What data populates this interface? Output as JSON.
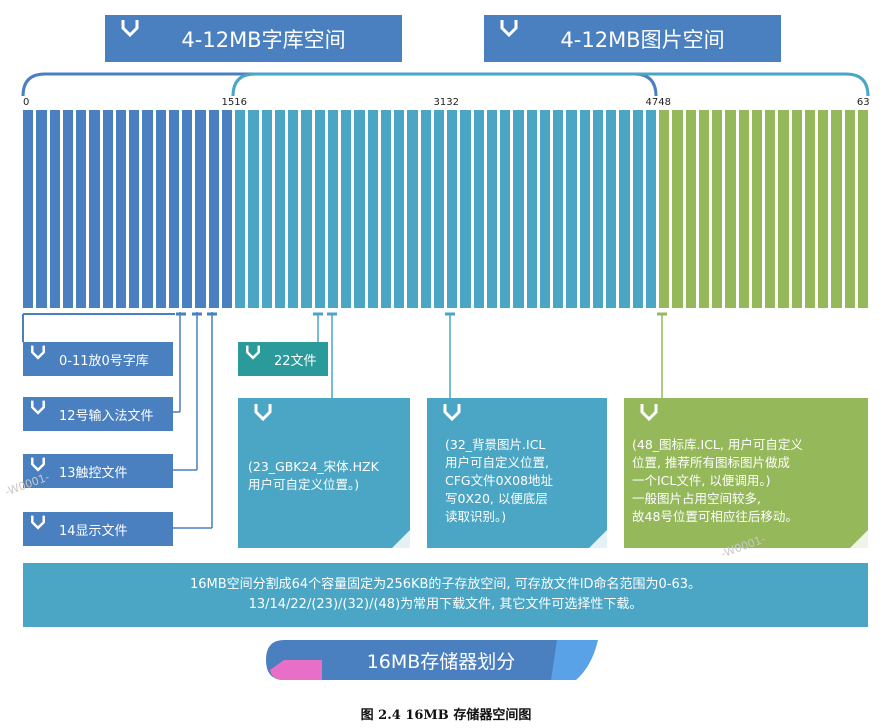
{
  "headers": {
    "font_space": "4-12MB字库空间",
    "image_space": "4-12MB图片空间"
  },
  "bar": {
    "cells": 64,
    "groups": [
      {
        "from": 0,
        "to": 15,
        "color": "#4a7fc0"
      },
      {
        "from": 16,
        "to": 47,
        "color": "#4aa6c4"
      },
      {
        "from": 48,
        "to": 63,
        "color": "#94b85a"
      }
    ],
    "labels": [
      {
        "text": "0",
        "index": 0
      },
      {
        "text": "1516",
        "index": 15.5
      },
      {
        "text": "3132",
        "index": 31.5
      },
      {
        "text": "4748",
        "index": 47.5
      },
      {
        "text": "63",
        "index": 63
      }
    ]
  },
  "tags": {
    "font0": "0-11放0号字库",
    "ime": "12号输入法文件",
    "touch": "13触控文件",
    "display": "14显示文件",
    "file22": "22文件"
  },
  "boxes": {
    "box23": [
      "(23_GBK24_宋体.HZK",
      "用户可自定义位置。)"
    ],
    "box32": [
      "(32_背景图片.ICL",
      "用户可自定义位置,",
      "CFG文件0X08地址",
      "写0X20, 以便底层",
      "读取识别。)"
    ],
    "box48": [
      "(48_图标库.ICL, 用户可自定义",
      "位置, 推荐所有图标图片做成",
      "一个ICL文件, 以便调用。)",
      "一般图片占用空间较多,",
      "故48号位置可相应往后移动。"
    ]
  },
  "info": {
    "line1": "16MB空间分割成64个容量固定为256KB的子存放空间, 可存放文件ID命名范围为0-63。",
    "line2": "13/14/22/(23)/(32)/(48)为常用下载文件, 其它文件可选择性下载。"
  },
  "title_banner": "16MB存储器划分",
  "caption": "图 2.4 16MB 存储器空间图",
  "watermarks": [
    "-W0001-",
    "-W0001-"
  ],
  "colors": {
    "blue": "#4a7fc0",
    "teal": "#4aa6c4",
    "green": "#94b85a",
    "darkteal": "#2b9a9a",
    "pink": "#e86fc8",
    "lightblue": "#5aa2e8"
  }
}
